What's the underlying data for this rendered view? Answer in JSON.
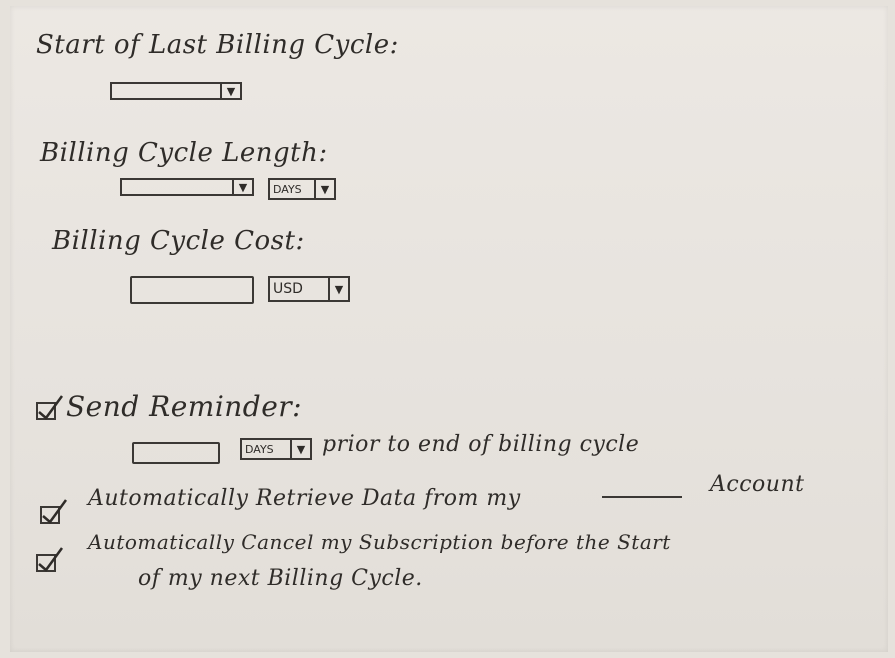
{
  "form": {
    "start_label": "Start of Last Billing Cycle:",
    "length_label": "Billing Cycle Length:",
    "length_unit": "DAYS",
    "cost_label": "Billing Cycle Cost:",
    "cost_currency": "USD",
    "reminder_label": "Send Reminder:",
    "reminder_unit": "DAYS",
    "reminder_suffix": "prior to end of billing cycle",
    "retrieve_label": "Automatically Retrieve Data from my",
    "retrieve_suffix": "Account",
    "cancel_label_line1": "Automatically Cancel my Subscription before the Start",
    "cancel_label_line2": "of my next Billing Cycle.",
    "dropdown_arrow": "▼"
  },
  "checks": {
    "send_reminder": true,
    "auto_retrieve": true,
    "auto_cancel": true
  }
}
